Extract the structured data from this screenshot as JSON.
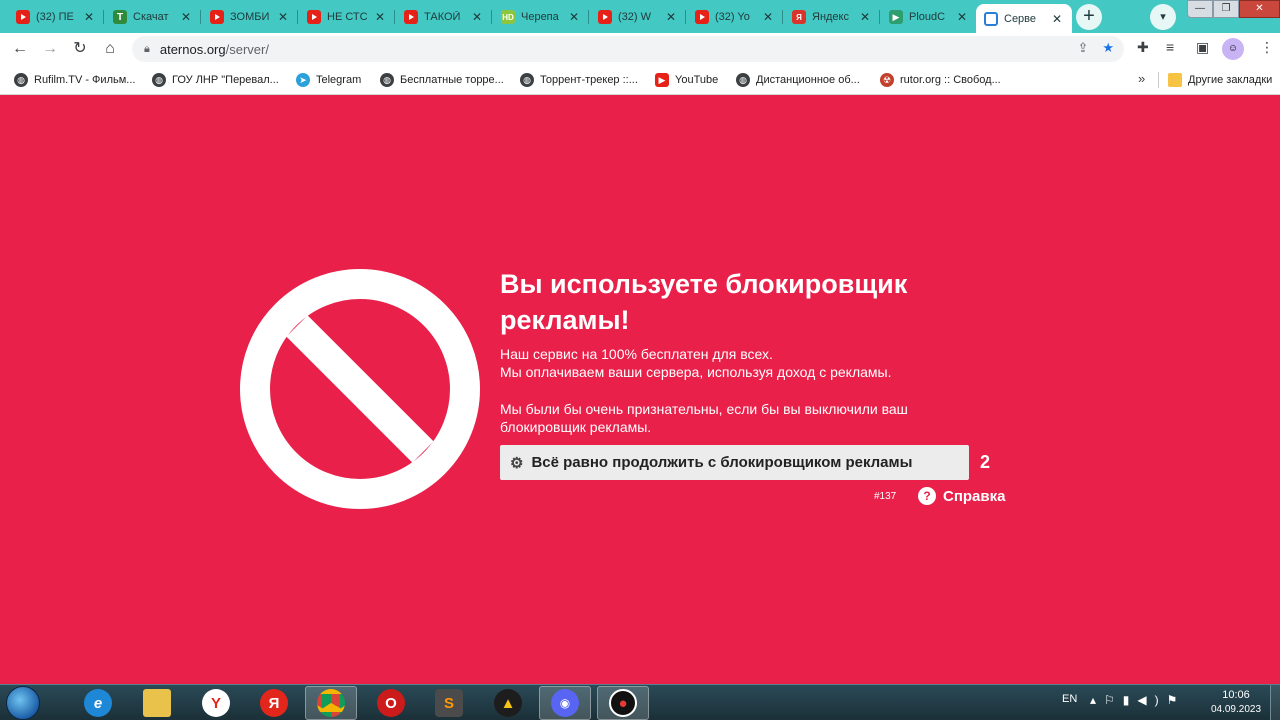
{
  "browser": {
    "tabs": [
      {
        "title": "(32) ПЕ",
        "icon": "youtube-icon"
      },
      {
        "title": "Скачат",
        "icon": "torrent-icon"
      },
      {
        "title": "ЗОМБИ",
        "icon": "youtube-icon"
      },
      {
        "title": "НЕ СТС",
        "icon": "youtube-icon"
      },
      {
        "title": "ТАКОЙ",
        "icon": "youtube-icon"
      },
      {
        "title": "Черепа",
        "icon": "hd-icon"
      },
      {
        "title": "(32) W",
        "icon": "youtube-icon"
      },
      {
        "title": "(32) Yo",
        "icon": "youtube-icon"
      },
      {
        "title": "Яндекс",
        "icon": "yandex-icon"
      },
      {
        "title": "PloudC",
        "icon": "play-icon"
      },
      {
        "title": "Серве",
        "icon": "aternos-icon",
        "active": true
      }
    ],
    "url_host": "aternos.org",
    "url_path": "/server/"
  },
  "bookmarks": [
    {
      "label": "Rufilm.TV - Фильм...",
      "icon": "globe-icon"
    },
    {
      "label": "ГОУ ЛНР \"Перевал...",
      "icon": "globe-icon"
    },
    {
      "label": "Telegram",
      "icon": "telegram-icon"
    },
    {
      "label": "Бесплатные торре...",
      "icon": "globe-icon"
    },
    {
      "label": "Торрент-трекер ::...",
      "icon": "globe-icon"
    },
    {
      "label": "YouTube",
      "icon": "youtube-icon"
    },
    {
      "label": "Дистанционное об...",
      "icon": "globe-icon"
    },
    {
      "label": "rutor.org :: Свобод...",
      "icon": "rutor-icon"
    }
  ],
  "other_bookmarks": "Другие закладки",
  "adblock": {
    "headline_line1": "Вы используете блокировщик",
    "headline_line2": "рекламы!",
    "para1_line1": "Наш сервис на 100% бесплатен для всех.",
    "para1_line2": "Мы оплачиваем ваши сервера, используя доход с рекламы.",
    "para2_line1": "Мы были бы очень признательны, если бы вы выключили ваш",
    "para2_line2": "блокировщик рекламы.",
    "continue_label": "Всё равно продолжить с блокировщиком рекламы",
    "counter": "2",
    "error_code": "#137",
    "help_label": "Справка",
    "accent_color": "#e8204a"
  },
  "taskbar": {
    "lang": "EN",
    "time": "10:06",
    "date": "04.09.2023"
  }
}
